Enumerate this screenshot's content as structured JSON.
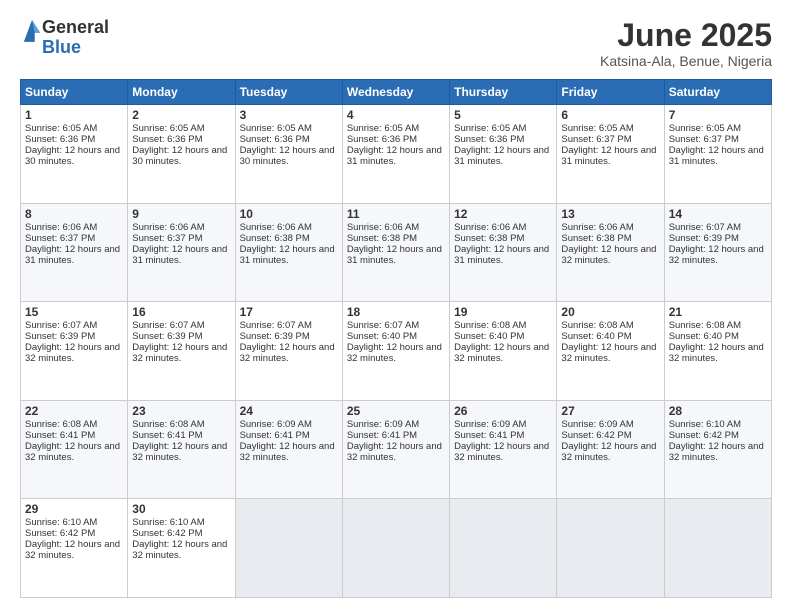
{
  "logo": {
    "general": "General",
    "blue": "Blue"
  },
  "header": {
    "month": "June 2025",
    "location": "Katsina-Ala, Benue, Nigeria"
  },
  "weekdays": [
    "Sunday",
    "Monday",
    "Tuesday",
    "Wednesday",
    "Thursday",
    "Friday",
    "Saturday"
  ],
  "weeks": [
    [
      {
        "day": "1",
        "rise": "6:05 AM",
        "set": "6:36 PM",
        "daylight": "12 hours and 30 minutes."
      },
      {
        "day": "2",
        "rise": "6:05 AM",
        "set": "6:36 PM",
        "daylight": "12 hours and 30 minutes."
      },
      {
        "day": "3",
        "rise": "6:05 AM",
        "set": "6:36 PM",
        "daylight": "12 hours and 30 minutes."
      },
      {
        "day": "4",
        "rise": "6:05 AM",
        "set": "6:36 PM",
        "daylight": "12 hours and 31 minutes."
      },
      {
        "day": "5",
        "rise": "6:05 AM",
        "set": "6:36 PM",
        "daylight": "12 hours and 31 minutes."
      },
      {
        "day": "6",
        "rise": "6:05 AM",
        "set": "6:37 PM",
        "daylight": "12 hours and 31 minutes."
      },
      {
        "day": "7",
        "rise": "6:05 AM",
        "set": "6:37 PM",
        "daylight": "12 hours and 31 minutes."
      }
    ],
    [
      {
        "day": "8",
        "rise": "6:06 AM",
        "set": "6:37 PM",
        "daylight": "12 hours and 31 minutes."
      },
      {
        "day": "9",
        "rise": "6:06 AM",
        "set": "6:37 PM",
        "daylight": "12 hours and 31 minutes."
      },
      {
        "day": "10",
        "rise": "6:06 AM",
        "set": "6:38 PM",
        "daylight": "12 hours and 31 minutes."
      },
      {
        "day": "11",
        "rise": "6:06 AM",
        "set": "6:38 PM",
        "daylight": "12 hours and 31 minutes."
      },
      {
        "day": "12",
        "rise": "6:06 AM",
        "set": "6:38 PM",
        "daylight": "12 hours and 31 minutes."
      },
      {
        "day": "13",
        "rise": "6:06 AM",
        "set": "6:38 PM",
        "daylight": "12 hours and 32 minutes."
      },
      {
        "day": "14",
        "rise": "6:07 AM",
        "set": "6:39 PM",
        "daylight": "12 hours and 32 minutes."
      }
    ],
    [
      {
        "day": "15",
        "rise": "6:07 AM",
        "set": "6:39 PM",
        "daylight": "12 hours and 32 minutes."
      },
      {
        "day": "16",
        "rise": "6:07 AM",
        "set": "6:39 PM",
        "daylight": "12 hours and 32 minutes."
      },
      {
        "day": "17",
        "rise": "6:07 AM",
        "set": "6:39 PM",
        "daylight": "12 hours and 32 minutes."
      },
      {
        "day": "18",
        "rise": "6:07 AM",
        "set": "6:40 PM",
        "daylight": "12 hours and 32 minutes."
      },
      {
        "day": "19",
        "rise": "6:08 AM",
        "set": "6:40 PM",
        "daylight": "12 hours and 32 minutes."
      },
      {
        "day": "20",
        "rise": "6:08 AM",
        "set": "6:40 PM",
        "daylight": "12 hours and 32 minutes."
      },
      {
        "day": "21",
        "rise": "6:08 AM",
        "set": "6:40 PM",
        "daylight": "12 hours and 32 minutes."
      }
    ],
    [
      {
        "day": "22",
        "rise": "6:08 AM",
        "set": "6:41 PM",
        "daylight": "12 hours and 32 minutes."
      },
      {
        "day": "23",
        "rise": "6:08 AM",
        "set": "6:41 PM",
        "daylight": "12 hours and 32 minutes."
      },
      {
        "day": "24",
        "rise": "6:09 AM",
        "set": "6:41 PM",
        "daylight": "12 hours and 32 minutes."
      },
      {
        "day": "25",
        "rise": "6:09 AM",
        "set": "6:41 PM",
        "daylight": "12 hours and 32 minutes."
      },
      {
        "day": "26",
        "rise": "6:09 AM",
        "set": "6:41 PM",
        "daylight": "12 hours and 32 minutes."
      },
      {
        "day": "27",
        "rise": "6:09 AM",
        "set": "6:42 PM",
        "daylight": "12 hours and 32 minutes."
      },
      {
        "day": "28",
        "rise": "6:10 AM",
        "set": "6:42 PM",
        "daylight": "12 hours and 32 minutes."
      }
    ],
    [
      {
        "day": "29",
        "rise": "6:10 AM",
        "set": "6:42 PM",
        "daylight": "12 hours and 32 minutes."
      },
      {
        "day": "30",
        "rise": "6:10 AM",
        "set": "6:42 PM",
        "daylight": "12 hours and 32 minutes."
      },
      null,
      null,
      null,
      null,
      null
    ]
  ]
}
